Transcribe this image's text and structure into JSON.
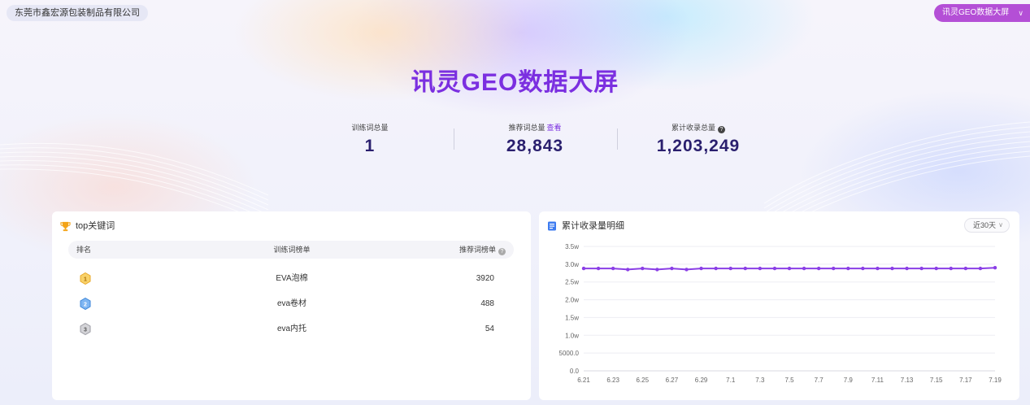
{
  "header": {
    "company": "东莞市鑫宏源包装制品有限公司",
    "screen_select": "讯灵GEO数据大屏",
    "title": "讯灵GEO数据大屏"
  },
  "stats": {
    "training_label": "训练词总量",
    "training_value": "1",
    "recommend_label": "推荐词总量",
    "recommend_link": "查看",
    "recommend_value": "28,843",
    "indexed_label": "累计收录总量",
    "indexed_value": "1,203,249"
  },
  "top_keywords": {
    "title": "top关键词",
    "columns": {
      "rank": "排名",
      "word": "训练词榜单",
      "recommend": "推荐词榜单"
    },
    "rows": [
      {
        "rank": "1",
        "word": "EVA泡棉",
        "count": "3920"
      },
      {
        "rank": "2",
        "word": "eva卷材",
        "count": "488"
      },
      {
        "rank": "3",
        "word": "eva内托",
        "count": "54"
      }
    ]
  },
  "index_detail": {
    "title": "累计收录量明细",
    "range": "近30天"
  },
  "chart_data": {
    "type": "line",
    "title": "",
    "xlabel": "",
    "ylabel": "",
    "ylim": [
      0,
      35000
    ],
    "y_ticks": [
      "0.0",
      "5000.0",
      "1.0w",
      "1.5w",
      "2.0w",
      "2.5w",
      "3.0w",
      "3.5w"
    ],
    "x_tick_labels": [
      "6.21",
      "6.23",
      "6.25",
      "6.27",
      "6.29",
      "7.1",
      "7.3",
      "7.5",
      "7.7",
      "7.9",
      "7.11",
      "7.13",
      "7.15",
      "7.17",
      "7.19"
    ],
    "x": [
      "6.21",
      "6.22",
      "6.23",
      "6.24",
      "6.25",
      "6.26",
      "6.27",
      "6.28",
      "6.29",
      "6.30",
      "7.1",
      "7.2",
      "7.3",
      "7.4",
      "7.5",
      "7.6",
      "7.7",
      "7.8",
      "7.9",
      "7.10",
      "7.11",
      "7.12",
      "7.13",
      "7.14",
      "7.15",
      "7.16",
      "7.17",
      "7.18",
      "7.19"
    ],
    "series": [
      {
        "values": [
          28800,
          28800,
          28800,
          28500,
          28800,
          28500,
          28800,
          28500,
          28800,
          28800,
          28800,
          28800,
          28800,
          28800,
          28800,
          28800,
          28800,
          28800,
          28800,
          28800,
          28800,
          28800,
          28800,
          28800,
          28800,
          28800,
          28800,
          28800,
          29000
        ],
        "color": "#8a3ee6"
      }
    ],
    "grid": true
  }
}
